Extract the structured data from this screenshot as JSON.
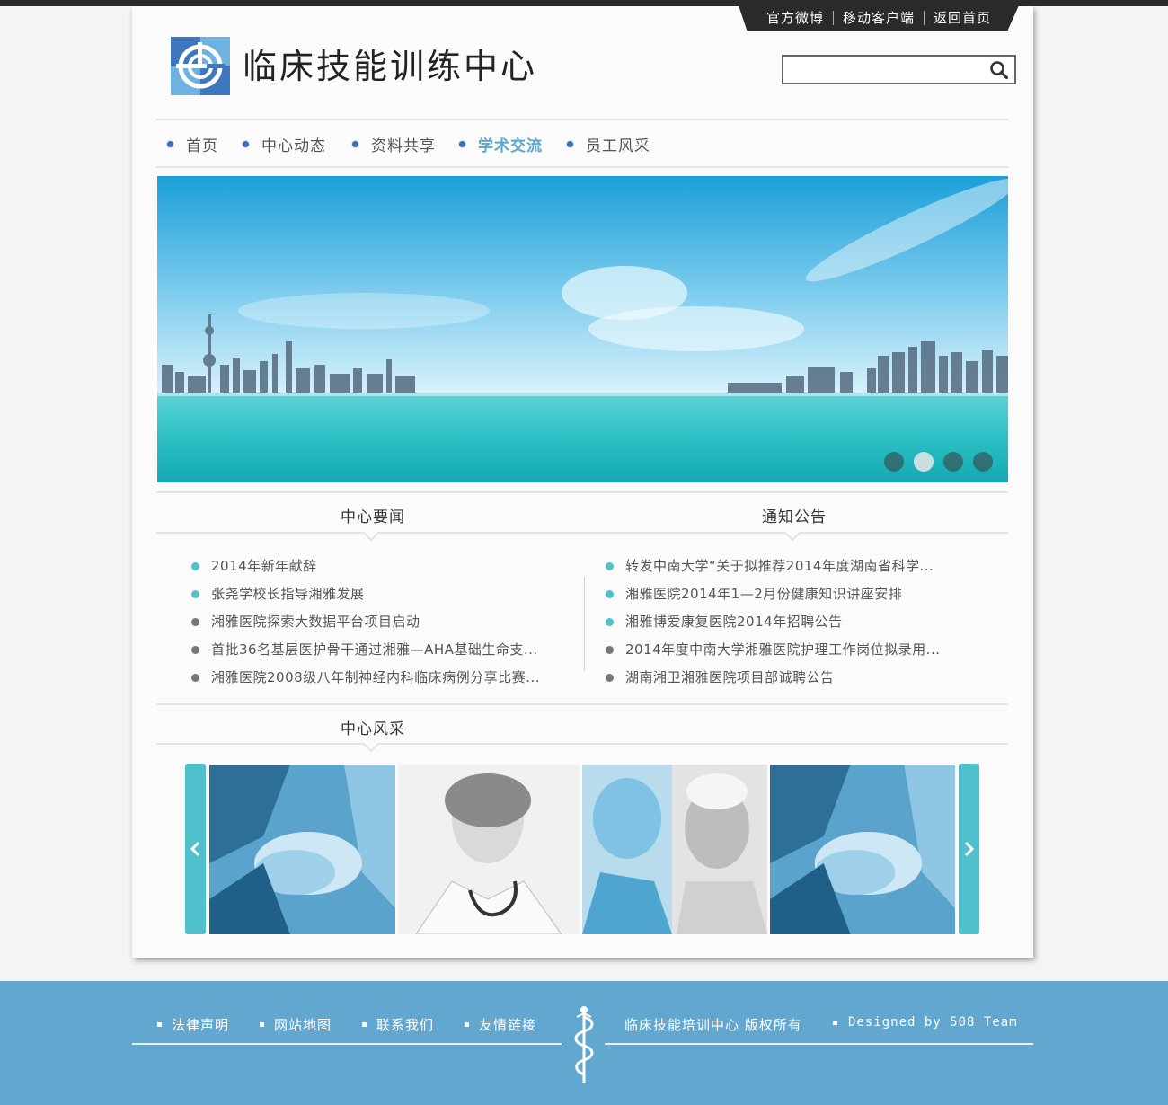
{
  "top_links": [
    "官方微博",
    "移动客户端",
    "返回首页"
  ],
  "site_title": "临床技能训练中心",
  "search": {
    "placeholder": ""
  },
  "nav": [
    {
      "label": "首页",
      "active": false
    },
    {
      "label": "中心动态",
      "active": false
    },
    {
      "label": "资料共享",
      "active": false
    },
    {
      "label": "学术交流",
      "active": true
    },
    {
      "label": "员工风采",
      "active": false
    }
  ],
  "banner": {
    "dot_count": 4,
    "active_dot": 2
  },
  "news": {
    "title": "中心要闻",
    "items": [
      {
        "text": "2014年新年献辞",
        "color": "teal"
      },
      {
        "text": "张尧学校长指导湘雅发展",
        "color": "teal"
      },
      {
        "text": "湘雅医院探索大数据平台项目启动",
        "color": "gray"
      },
      {
        "text": "首批36名基层医护骨干通过湘雅—AHA基础生命支...",
        "color": "gray"
      },
      {
        "text": "湘雅医院2008级八年制神经内科临床病例分享比赛...",
        "color": "gray"
      }
    ]
  },
  "notices": {
    "title": "通知公告",
    "items": [
      {
        "text": "转发中南大学“关于拟推荐2014年度湖南省科学...",
        "color": "teal"
      },
      {
        "text": "湘雅医院2014年1—2月份健康知识讲座安排",
        "color": "teal"
      },
      {
        "text": "湘雅博爱康复医院2014年招聘公告",
        "color": "teal"
      },
      {
        "text": "2014年度中南大学湘雅医院护理工作岗位拟录用...",
        "color": "gray"
      },
      {
        "text": "湖南湘卫湘雅医院项目部诚聘公告",
        "color": "gray"
      }
    ]
  },
  "gallery": {
    "title": "中心风采"
  },
  "footer": {
    "links": [
      "法律声明",
      "网站地图",
      "联系我们",
      "友情链接"
    ],
    "copyright": "临床技能培训中心 版权所有",
    "designed_by": "Designed by 508 Team"
  },
  "colors": {
    "accent": "#4fc0cc",
    "footer_bg": "#62a7cf",
    "nav_active": "#5aa8cc",
    "topbar": "#2a2a2a"
  }
}
